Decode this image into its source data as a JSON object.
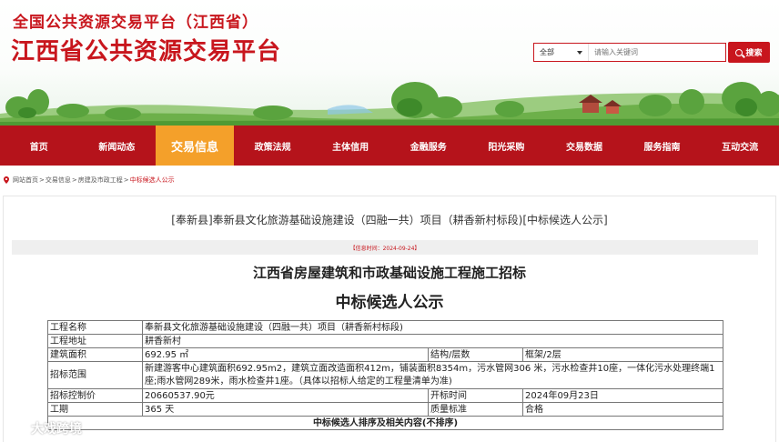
{
  "header": {
    "subtitle": "全国公共资源交易平台（江西省）",
    "title": "江西省公共资源交易平台"
  },
  "search": {
    "category": "全部",
    "placeholder": "请输入关键词",
    "button_label": "搜索"
  },
  "nav": {
    "items": [
      "首页",
      "新闻动态",
      "交易信息",
      "政策法规",
      "主体信用",
      "金融服务",
      "阳光采购",
      "交易数据",
      "服务指南",
      "互动交流"
    ],
    "active_index": 2
  },
  "breadcrumb": {
    "items": [
      "网站首页",
      "交易信息",
      "房建及市政工程",
      "中标候选人公示"
    ]
  },
  "article": {
    "title": "[奉新县]奉新县文化旅游基础设施建设（四融一共）项目（耕香新村标段)[中标候选人公示]",
    "info": "【信息时间：2024-09-24】",
    "heading1": "江西省房屋建筑和市政基础设施工程施工招标",
    "heading2": "中标候选人公示"
  },
  "table": {
    "project_name_label": "工程名称",
    "project_name": "奉新县文化旅游基础设施建设（四融一共）项目（耕香新村标段)",
    "address_label": "工程地址",
    "address": "耕香新村",
    "area_label": "建筑面积",
    "area": "692.95 ㎡",
    "structure_label": "结构/层数",
    "structure": "框架/2层",
    "scope_label": "招标范围",
    "scope": "新建游客中心建筑面积692.95m2，建筑立面改造面积412m，铺装面积8354m，污水管网306 米，污水检查井10座，一体化污水处理终端1座;雨水管网289米，雨水检查井1座。（具体以招标人给定的工程量清单为准)",
    "price_label": "招标控制价",
    "price": "20660537.90元",
    "start_label": "开标时间",
    "start": "2024年09月23日",
    "duration_label": "工期",
    "duration": "365 天",
    "quality_label": "质量标准",
    "quality": "合格",
    "section_title": "中标候选人排序及相关内容(不排序)"
  },
  "watermark": {
    "text": "大戏跨境"
  },
  "colors": {
    "brand_red": "#c8161d",
    "nav_red": "#b5131b",
    "nav_active": "#f4a02a"
  }
}
